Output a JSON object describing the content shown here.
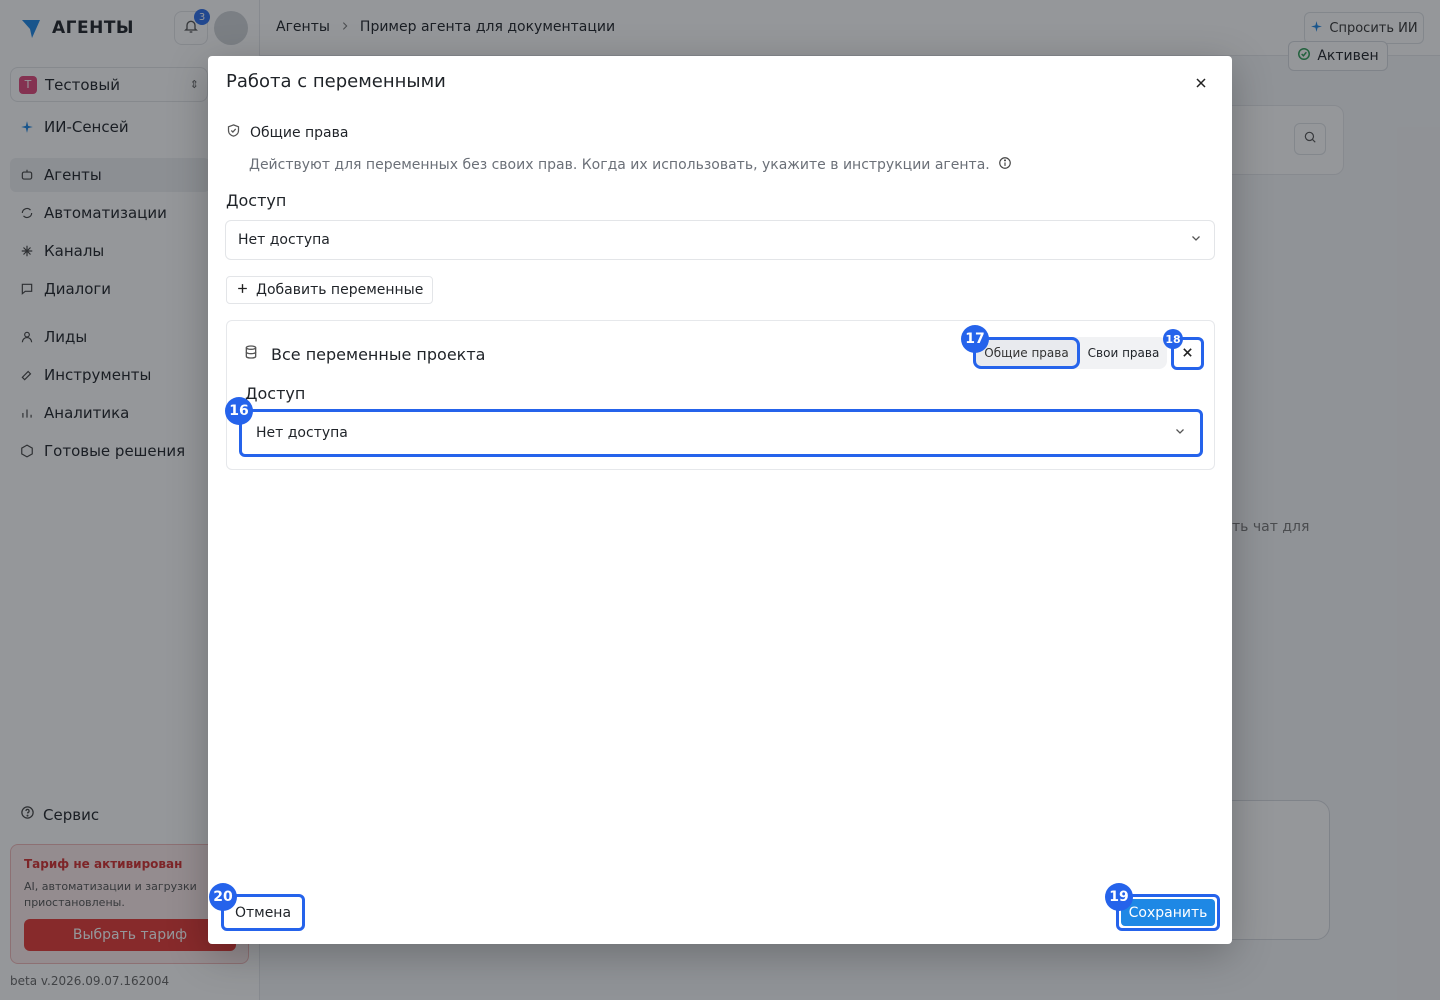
{
  "app": {
    "logo_text": "АГЕНТЫ",
    "notifications_count": "3",
    "workspace": {
      "letter": "Т",
      "name": "Тестовый"
    },
    "nav": [
      {
        "label": "ИИ-Сенсей",
        "icon": "sparkle-icon"
      },
      {
        "label": "Агенты",
        "icon": "bot-icon",
        "active": true
      },
      {
        "label": "Автоматизации",
        "icon": "automation-icon"
      },
      {
        "label": "Каналы",
        "icon": "channels-icon"
      },
      {
        "label": "Диалоги",
        "icon": "dialogs-icon"
      },
      {
        "label": "Лиды",
        "icon": "leads-icon"
      },
      {
        "label": "Инструменты",
        "icon": "tools-icon"
      },
      {
        "label": "Аналитика",
        "icon": "analytics-icon"
      },
      {
        "label": "Готовые решения",
        "icon": "solutions-icon"
      }
    ],
    "service_label": "Сервис",
    "tariff": {
      "title": "Тариф не активирован",
      "text": "AI, автоматизации и загрузки приостановлены.",
      "button": "Выбрать тариф"
    },
    "version": "beta v.2026.09.07.162004"
  },
  "topbar": {
    "breadcrumb": [
      "Агенты",
      "Пример агента для документации"
    ],
    "ask_ai": "Спросить ИИ",
    "status": "Активен"
  },
  "background": {
    "chat_hint": "ть чат для"
  },
  "modal": {
    "title": "Работа с переменными",
    "general_rights": {
      "label": "Общие права",
      "description": "Действуют для переменных без своих прав. Когда их использовать, укажите в инструкции агента."
    },
    "access_label": "Доступ",
    "access_value": "Нет доступа",
    "add_variables": "Добавить переменные",
    "variable_card": {
      "title": "Все переменные проекта",
      "segments": [
        "Общие права",
        "Свои права"
      ],
      "selected_segment": "Общие права",
      "access_label": "Доступ",
      "access_value": "Нет доступа"
    },
    "cancel": "Отмена",
    "save": "Сохранить"
  },
  "annotations": {
    "access_select": "16",
    "general_rights_segment": "17",
    "card_close": "18",
    "save": "19",
    "cancel": "20"
  },
  "colors": {
    "accent": "#2563eb",
    "save_button": "#1e88e5",
    "danger": "#e53935",
    "overlay": "rgba(20,24,30,0.45)"
  }
}
